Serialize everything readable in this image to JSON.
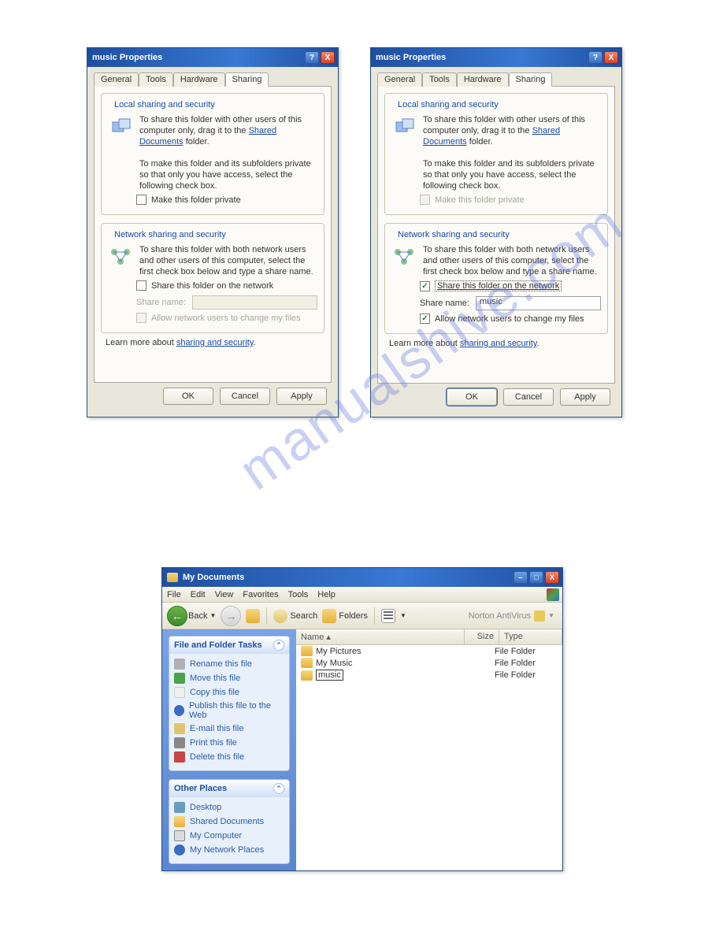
{
  "watermark": "manualshive.com",
  "dialog": {
    "title": "music Properties",
    "help_glyph": "?",
    "close_glyph": "X",
    "tabs": {
      "general": "General",
      "tools": "Tools",
      "hardware": "Hardware",
      "sharing": "Sharing"
    },
    "local": {
      "legend": "Local sharing and security",
      "text1a": "To share this folder with other users of this computer only, drag it to the ",
      "link": "Shared Documents",
      "text1b": " folder.",
      "text2": "To make this folder and its subfolders private so that only you have access, select the following check box.",
      "chk_label": "Make this folder private"
    },
    "network": {
      "legend": "Network sharing and security",
      "text": "To share this folder with both network users and other users of this computer, select the first check box below and type a share name.",
      "chk1": "Share this folder on the network",
      "share_label": "Share name:",
      "share_value_left": "",
      "share_value_right": "music",
      "chk2": "Allow network users to change my files"
    },
    "learn_pre": "Learn more about ",
    "learn_link": "sharing and security",
    "buttons": {
      "ok": "OK",
      "cancel": "Cancel",
      "apply": "Apply"
    }
  },
  "explorer": {
    "title": "My Documents",
    "menu": {
      "file": "File",
      "edit": "Edit",
      "view": "View",
      "favorites": "Favorites",
      "tools": "Tools",
      "help": "Help"
    },
    "toolbar": {
      "back": "Back",
      "search": "Search",
      "folders": "Folders",
      "antivirus": "Norton AntiVirus"
    },
    "columns": {
      "name": "Name",
      "size": "Size",
      "type": "Type"
    },
    "files": [
      {
        "name": "My Pictures",
        "size": "",
        "type": "File Folder",
        "sel": false
      },
      {
        "name": "My Music",
        "size": "",
        "type": "File Folder",
        "sel": false
      },
      {
        "name": "music",
        "size": "",
        "type": "File Folder",
        "sel": true
      }
    ],
    "panel_tasks": {
      "title": "File and Folder Tasks",
      "items": {
        "rename": "Rename this file",
        "move": "Move this file",
        "copy": "Copy this file",
        "publish": "Publish this file to the Web",
        "email": "E-mail this file",
        "print": "Print this file",
        "delete": "Delete this file"
      }
    },
    "panel_places": {
      "title": "Other Places",
      "items": {
        "desktop": "Desktop",
        "shared": "Shared Documents",
        "computer": "My Computer",
        "network": "My Network Places"
      }
    }
  }
}
